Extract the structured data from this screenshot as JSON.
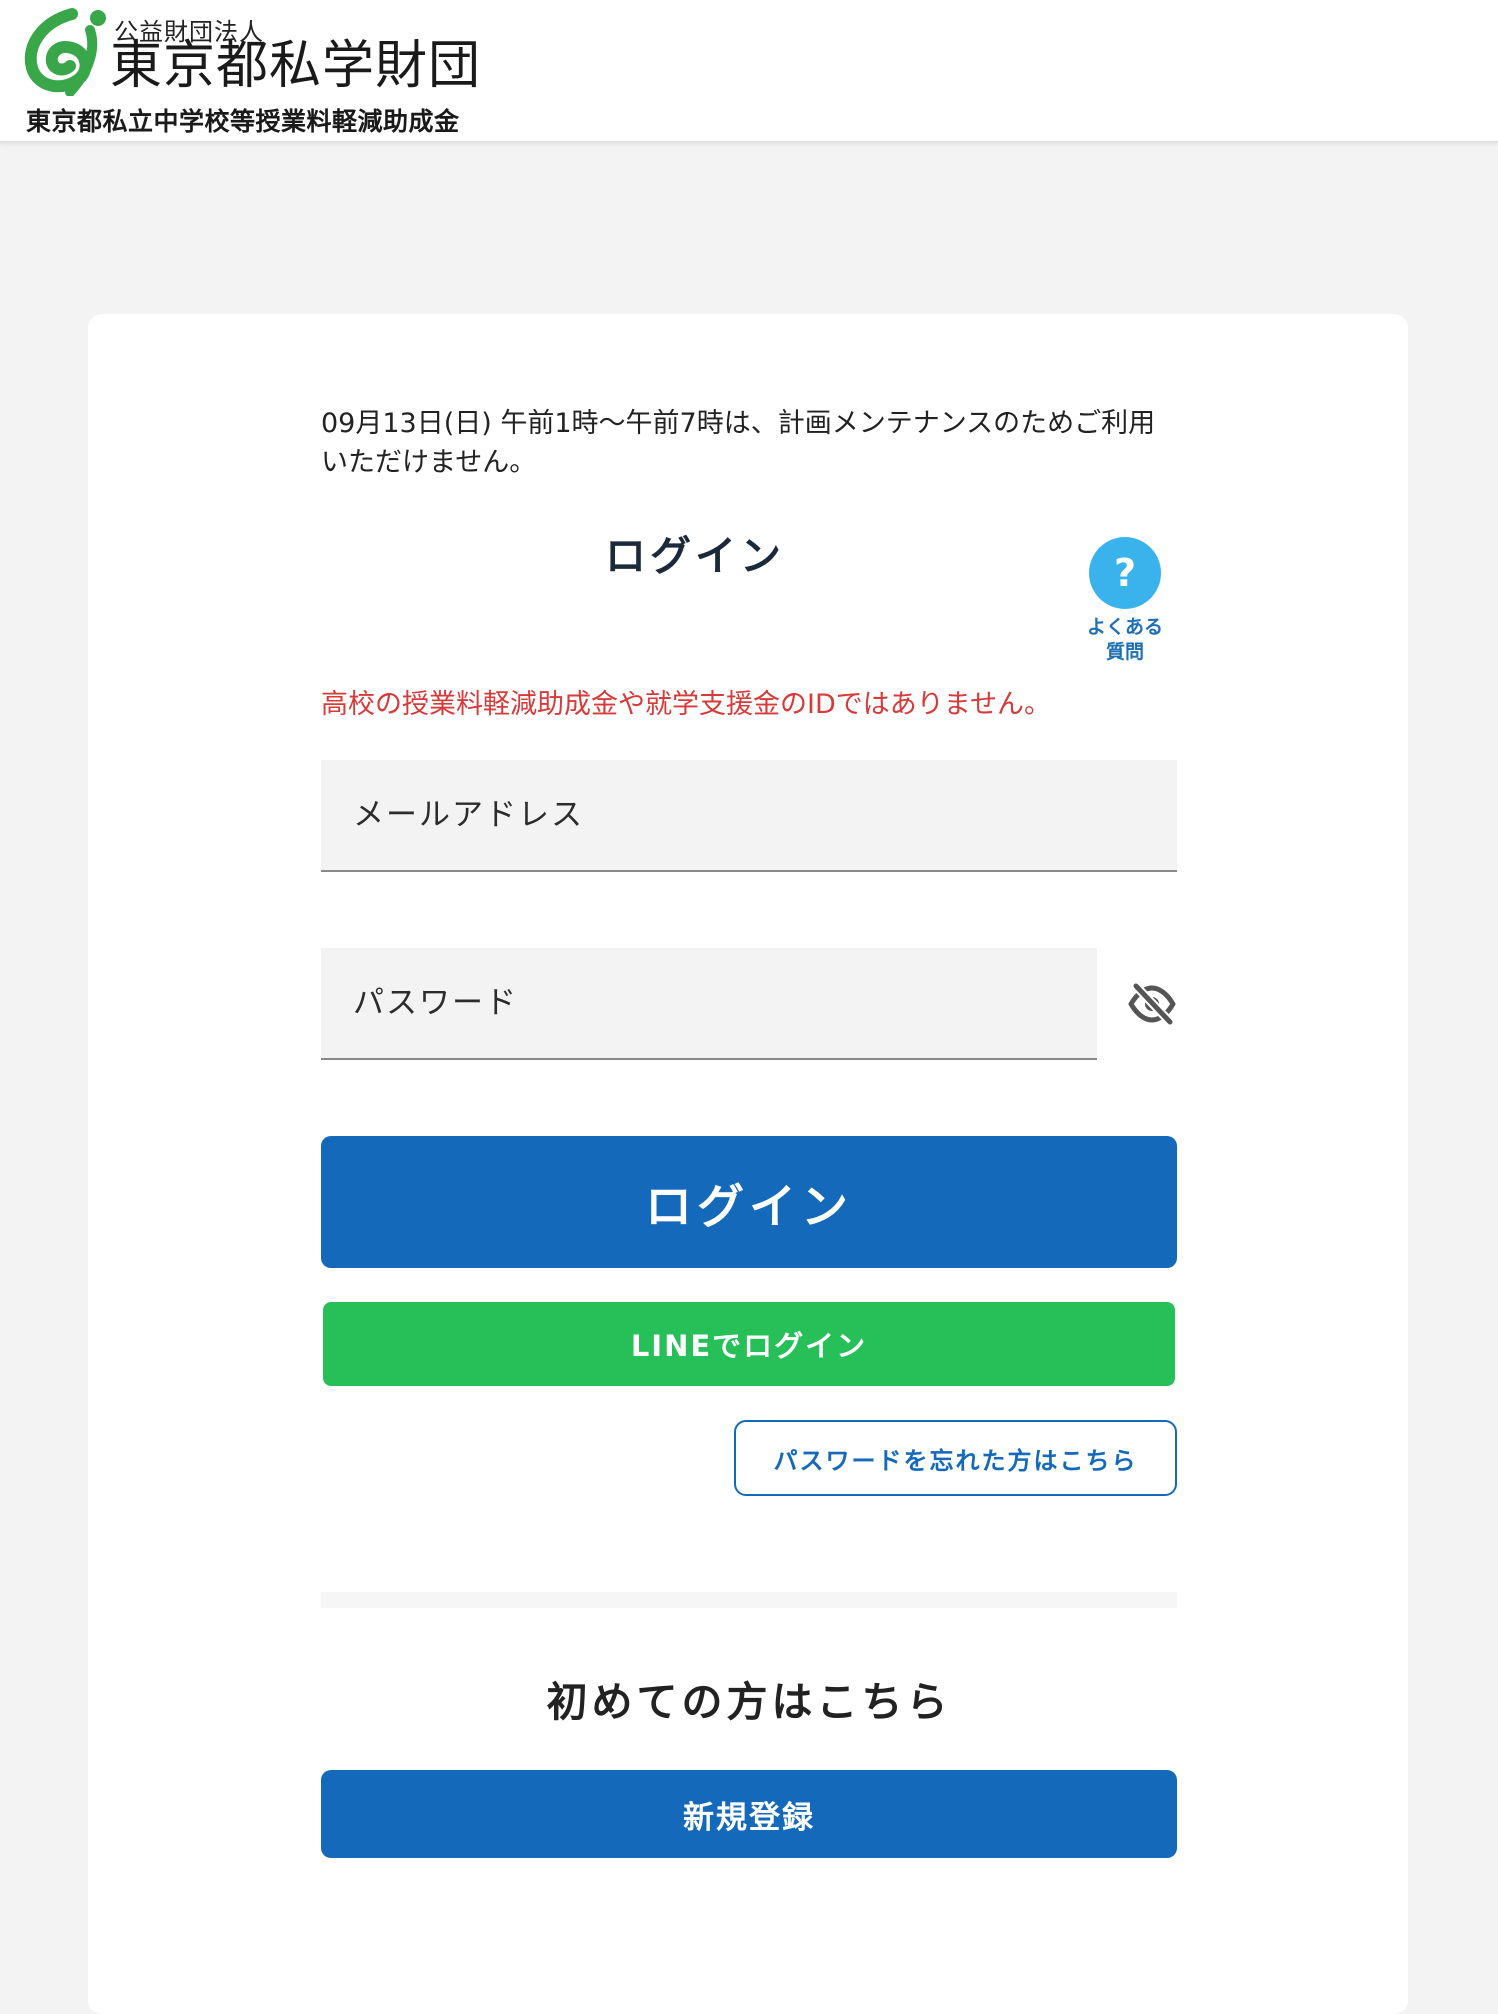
{
  "header": {
    "org_small": "公益財団法人",
    "org_name": "東京都私学財団",
    "subtitle": "東京都私立中学校等授業料軽減助成金",
    "logo_icon": "foundation-logo-icon"
  },
  "notice": "09月13日(日) 午前1時〜午前7時は、計画メンテナンスのためご利用いただけません。",
  "login": {
    "title": "ログイン",
    "warning": "高校の授業料軽減助成金や就学支援金のIDではありません。",
    "email_placeholder": "メールアドレス",
    "password_placeholder": "パスワード",
    "password_toggle_icon": "eye-slash-icon",
    "login_button": "ログイン",
    "line_login_button": "LINEでログイン",
    "forgot_password_button": "パスワードを忘れた方はこちら"
  },
  "faq": {
    "icon_text": "?",
    "label_line1": "よくある",
    "label_line2": "質問"
  },
  "signup": {
    "heading": "初めての方はこちら",
    "register_button": "新規登録"
  },
  "colors": {
    "primary": "#1569bb",
    "line_green": "#27bf58",
    "warning_red": "#d83a3a",
    "faq_blue": "#3ab3ec",
    "logo_green": "#3aa64a"
  }
}
